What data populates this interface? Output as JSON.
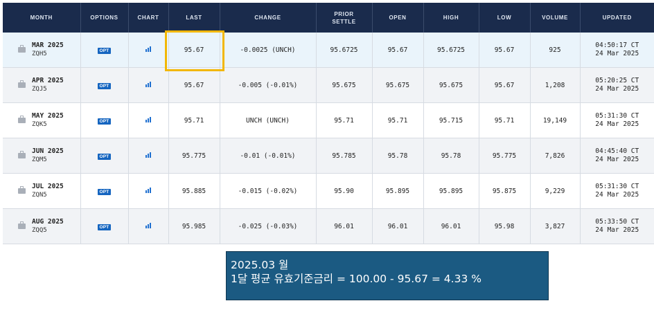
{
  "headers": [
    "MONTH",
    "OPTIONS",
    "CHART",
    "LAST",
    "CHANGE",
    "PRIOR\nSETTLE",
    "OPEN",
    "HIGH",
    "LOW",
    "VOLUME",
    "UPDATED"
  ],
  "rows": [
    {
      "month": "MAR 2025",
      "code": "ZQH5",
      "option": "OPT",
      "last": "95.67",
      "change": "-0.0025 (UNCH)",
      "change_negative": true,
      "prior_settle": "95.6725",
      "open": "95.67",
      "high": "95.6725",
      "low": "95.67",
      "volume": "925",
      "updated_time": "04:50:17 CT",
      "updated_date": "24 Mar 2025"
    },
    {
      "month": "APR 2025",
      "code": "ZQJ5",
      "option": "OPT",
      "last": "95.67",
      "change": "-0.005 (-0.01%)",
      "change_negative": true,
      "prior_settle": "95.675",
      "open": "95.675",
      "high": "95.675",
      "low": "95.67",
      "volume": "1,208",
      "updated_time": "05:20:25 CT",
      "updated_date": "24 Mar 2025"
    },
    {
      "month": "MAY 2025",
      "code": "ZQK5",
      "option": "OPT",
      "last": "95.71",
      "change": "UNCH (UNCH)",
      "change_negative": false,
      "prior_settle": "95.71",
      "open": "95.71",
      "high": "95.715",
      "low": "95.71",
      "volume": "19,149",
      "updated_time": "05:31:30 CT",
      "updated_date": "24 Mar 2025"
    },
    {
      "month": "JUN 2025",
      "code": "ZQM5",
      "option": "OPT",
      "last": "95.775",
      "change": "-0.01 (-0.01%)",
      "change_negative": true,
      "prior_settle": "95.785",
      "open": "95.78",
      "high": "95.78",
      "low": "95.775",
      "volume": "7,826",
      "updated_time": "04:45:40 CT",
      "updated_date": "24 Mar 2025"
    },
    {
      "month": "JUL 2025",
      "code": "ZQN5",
      "option": "OPT",
      "last": "95.885",
      "change": "-0.015 (-0.02%)",
      "change_negative": true,
      "prior_settle": "95.90",
      "open": "95.895",
      "high": "95.895",
      "low": "95.875",
      "volume": "9,229",
      "updated_time": "05:31:30 CT",
      "updated_date": "24 Mar 2025"
    },
    {
      "month": "AUG 2025",
      "code": "ZQQ5",
      "option": "OPT",
      "last": "95.985",
      "change": "-0.025 (-0.03%)",
      "change_negative": true,
      "prior_settle": "96.01",
      "open": "96.01",
      "high": "96.01",
      "low": "95.98",
      "volume": "3,827",
      "updated_time": "05:33:50 CT",
      "updated_date": "24 Mar 2025"
    }
  ],
  "note": {
    "line1": "2025.03 월",
    "line2": "1달 평균 유효기준금리 = 100.00 - 95.67 = 4.33 %"
  },
  "colors": {
    "header_bg": "#1a2b4c",
    "negative": "#e02626",
    "opt_badge": "#1565c0",
    "highlight_border": "#f2b705",
    "note_bg": "#1b5a82"
  }
}
